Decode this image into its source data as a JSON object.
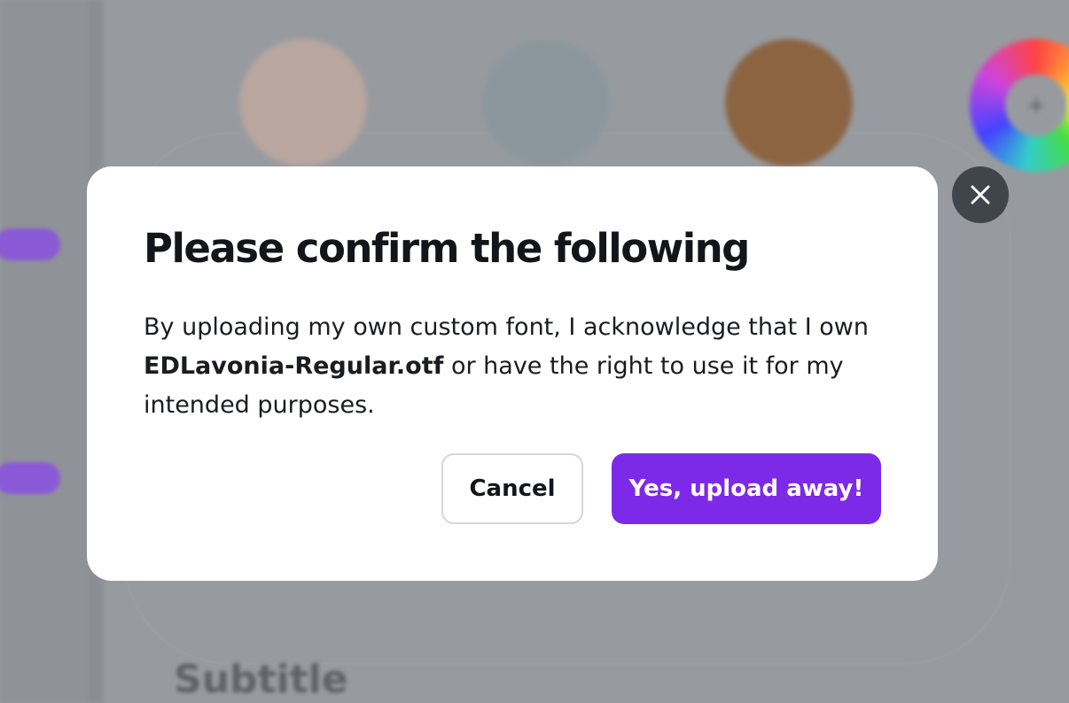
{
  "background": {
    "subtitle_text": "Subtitle",
    "swatches": [
      {
        "name": "peach",
        "color": "#b8a69f"
      },
      {
        "name": "blue-grey",
        "color": "#8c979d"
      },
      {
        "name": "brown",
        "color": "#8c6442"
      }
    ],
    "color_wheel_icon": "plus-icon"
  },
  "dialog": {
    "title": "Please confirm the following",
    "body_prefix": "By uploading my own custom font, I acknowledge that I own ",
    "file_name": "EDLavonia-Regular.otf",
    "body_suffix": " or have the right to use it for my intended purposes.",
    "cancel_label": "Cancel",
    "confirm_label": "Yes, upload away!",
    "close_icon": "close-icon"
  },
  "colors": {
    "accent": "#7d2ae8",
    "overlay": "#979ba0",
    "close_button_bg": "#40444b"
  }
}
